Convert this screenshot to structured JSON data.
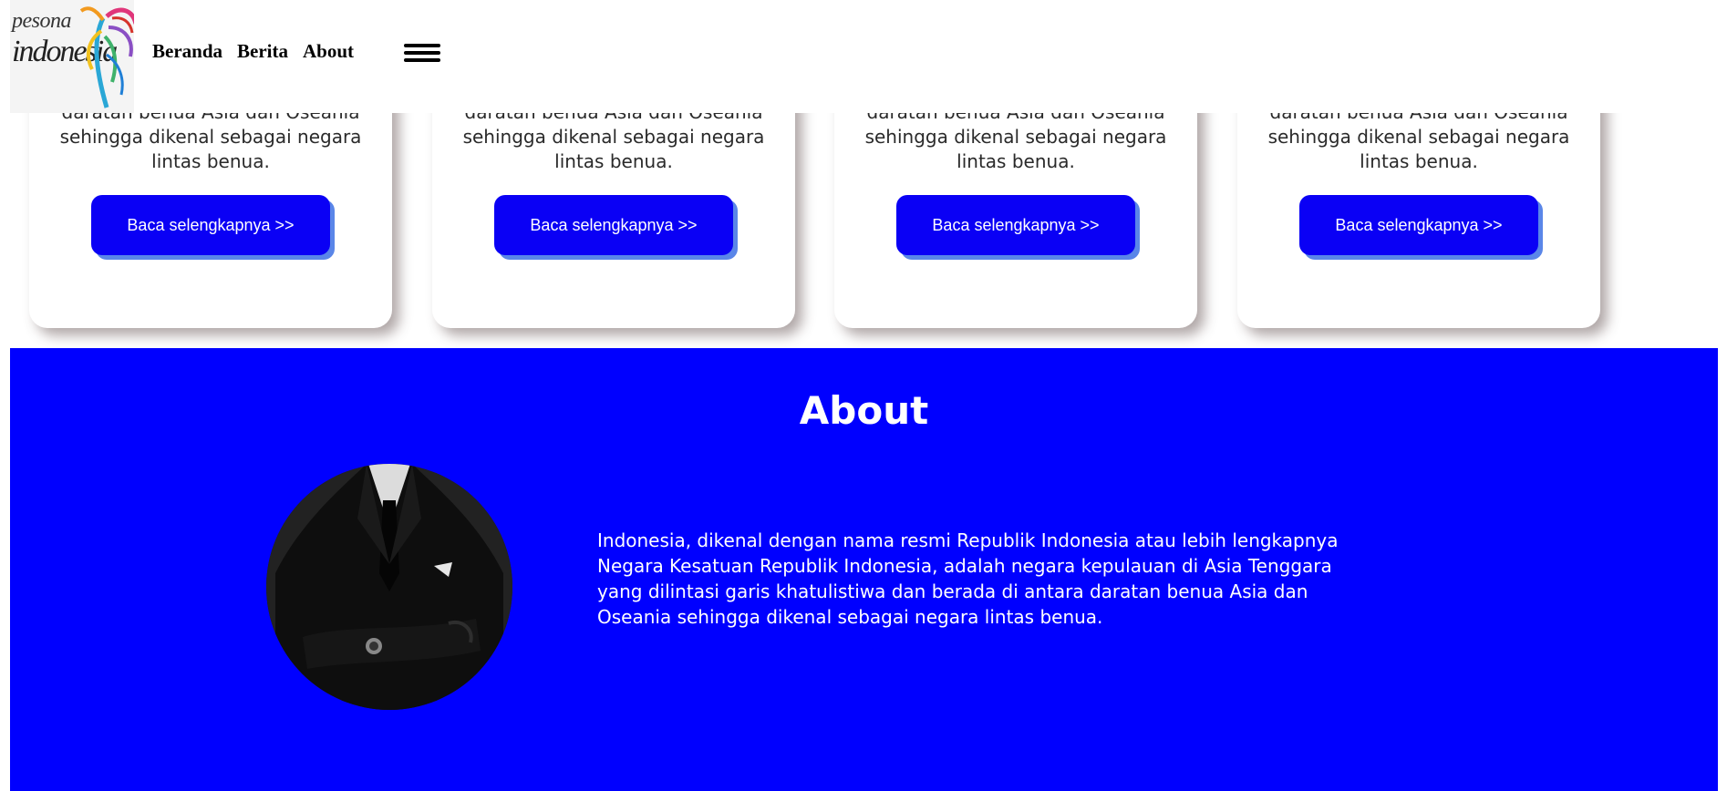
{
  "header": {
    "logo": {
      "line1": "pesona",
      "line2": "indonesia"
    },
    "nav": [
      {
        "label": "Beranda"
      },
      {
        "label": "Berita"
      },
      {
        "label": "About"
      }
    ],
    "menu_icon": "hamburger-menu-icon"
  },
  "cards": [
    {
      "text": "daratan benua Asia dan Oseania sehingga dikenal sebagai negara lintas benua.",
      "button_label": "Baca selengkapnya >>"
    },
    {
      "text": "daratan benua Asia dan Oseania sehingga dikenal sebagai negara lintas benua.",
      "button_label": "Baca selengkapnya >>"
    },
    {
      "text": "daratan benua Asia dan Oseania sehingga dikenal sebagai negara lintas benua.",
      "button_label": "Baca selengkapnya >>"
    },
    {
      "text": "daratan benua Asia dan Oseania sehingga dikenal sebagai negara lintas benua.",
      "button_label": "Baca selengkapnya >>"
    }
  ],
  "about": {
    "title": "About",
    "text": "Indonesia, dikenal dengan nama resmi Republik Indonesia atau lebih lengkapnya Negara Kesatuan Republik Indonesia, adalah negara kepulauan di Asia Tenggara yang dilintasi garis khatulistiwa dan berada di antara daratan benua Asia dan Oseania sehingga dikenal sebagai negara lintas benua."
  },
  "colors": {
    "primary_blue": "#0000ff",
    "button_blue": "#0a00f5",
    "button_shadow": "#5a86e8",
    "text_white": "#ffffff"
  }
}
